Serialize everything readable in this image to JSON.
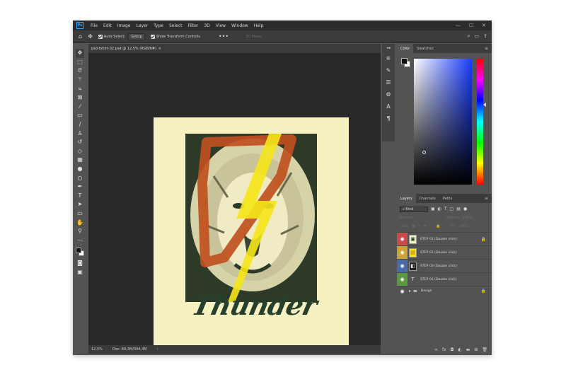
{
  "menubar": {
    "logo": "Ps",
    "items": [
      "File",
      "Edit",
      "Image",
      "Layer",
      "Type",
      "Select",
      "Filter",
      "3D",
      "View",
      "Window",
      "Help"
    ],
    "window_controls": [
      "—",
      "☐",
      "✕"
    ]
  },
  "options": {
    "auto_select_label": "Auto-Select:",
    "auto_select_value": "Group",
    "transform_controls_label": "Show Transform Controls",
    "mode_3d_label": "3D Mode:"
  },
  "document": {
    "tab_title": "psd-tshirt-02.psd @ 12,5% (RGB/8#)",
    "tab_close": "×",
    "artwork_text": "Thunder",
    "colors": {
      "paper": "#f6f1c0",
      "art_bg": "#2d3a27",
      "orange": "#c0501f",
      "yellow": "#f5e61a",
      "ink": "#26402d"
    }
  },
  "status": {
    "zoom": "12,5%",
    "doc_size": "Doc: 69,3M/394,4M",
    "arrow": "›"
  },
  "color_panel": {
    "tabs": [
      "Color",
      "Swatches"
    ],
    "menu_icon": "≡"
  },
  "layers_panel": {
    "tabs": [
      "Layers",
      "Channels",
      "Paths"
    ],
    "kind_label": "Kind",
    "blend_mode": "Normal",
    "opacity_label": "Opacity:",
    "opacity_value": "100%",
    "lock_label": "Lock:",
    "fill_label": "Fill:",
    "fill_value": "100%",
    "layers": [
      {
        "name": "STEP 01 (Double click)",
        "color": "#c94b4b",
        "thumb": "▣",
        "locked": true
      },
      {
        "name": "STEP 02 (Double click)",
        "color": "#c9a43a",
        "thumb": "▤",
        "locked": false
      },
      {
        "name": "STEP 03 (Double click)",
        "color": "#4a6aa8",
        "thumb": "◧",
        "locked": false
      },
      {
        "name": "STEP 04 (Double click)",
        "color": "#5a9a3f",
        "thumb": "T",
        "locked": false
      },
      {
        "name": "Design",
        "color": "",
        "thumb": "▸",
        "locked": true
      }
    ]
  }
}
